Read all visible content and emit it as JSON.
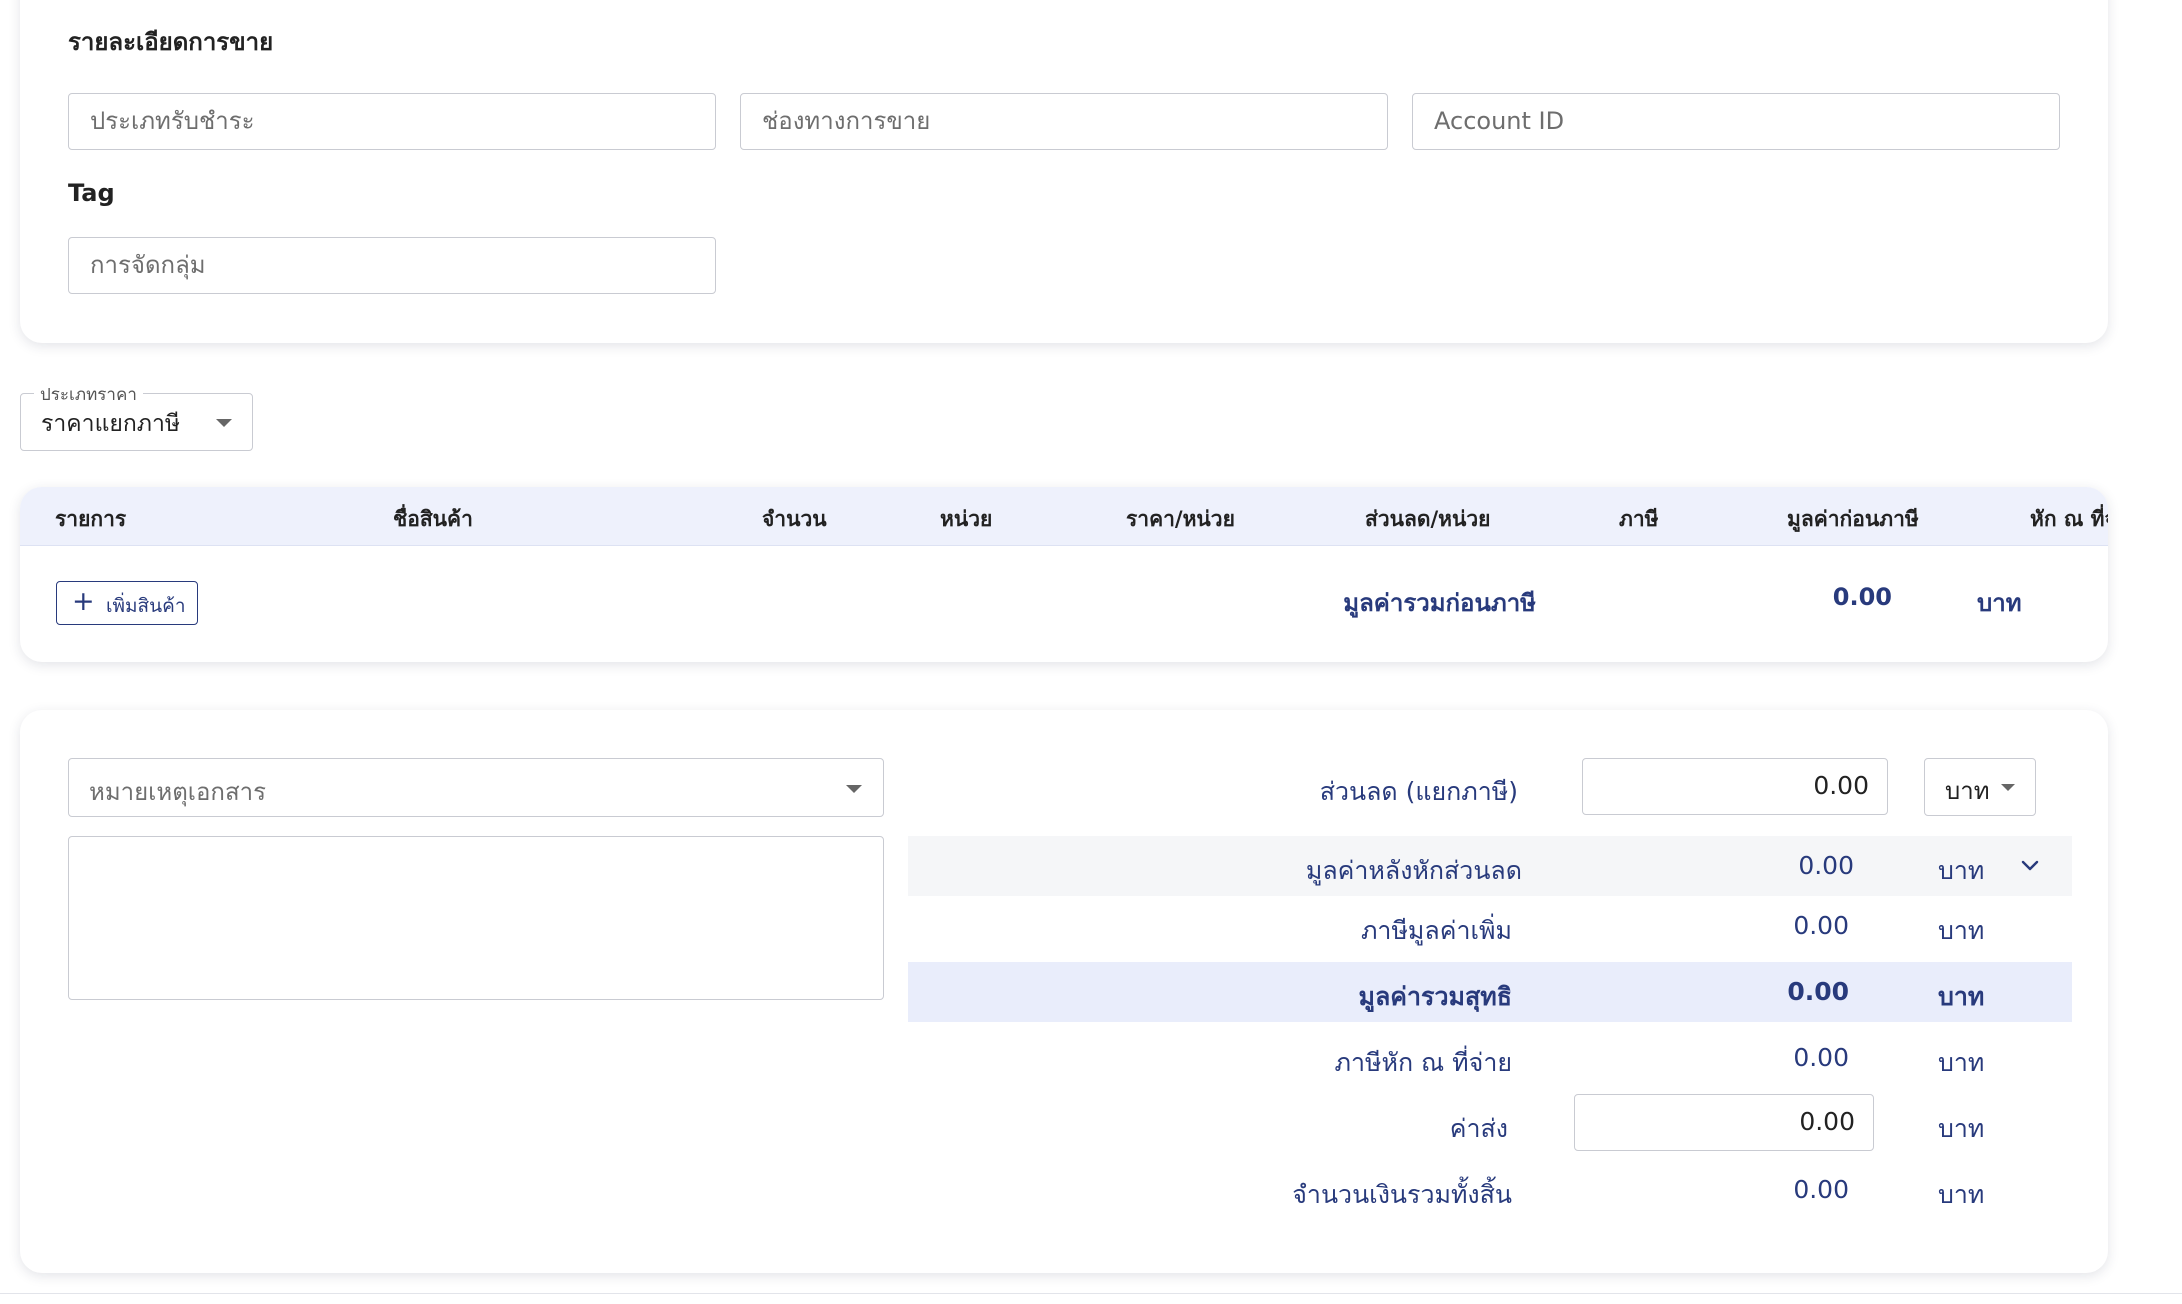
{
  "sales_detail": {
    "title": "รายละเอียดการขาย",
    "payment_type_placeholder": "ประเภทรับชำระ",
    "sales_channel_placeholder": "ช่องทางการขาย",
    "account_id_placeholder": "Account ID",
    "tag_label": "Tag",
    "grouping_placeholder": "การจัดกลุ่ม"
  },
  "price_type": {
    "label": "ประเภทราคา",
    "value": "ราคาแยกภาษี"
  },
  "items_table": {
    "columns": [
      "รายการ",
      "ชื่อสินค้า",
      "จำนวน",
      "หน่วย",
      "ราคา/หน่วย",
      "ส่วนลด/หน่วย",
      "ภาษี",
      "มูลค่าก่อนภาษี",
      "หัก ณ ที่จ่"
    ],
    "add_product_label": "เพิ่มสินค้า",
    "subtotal_label": "มูลค่ารวมก่อนภาษี",
    "subtotal_value": "0.00",
    "currency": "บาท"
  },
  "notes": {
    "dropdown_placeholder": "หมายเหตุเอกสาร",
    "textarea_value": ""
  },
  "summary": {
    "discount_label": "ส่วนลด (แยกภาษี)",
    "discount_value": "0.00",
    "discount_unit": "บาท",
    "after_discount_label": "มูลค่าหลังหักส่วนลด",
    "after_discount_value": "0.00",
    "vat_label": "ภาษีมูลค่าเพิ่ม",
    "vat_value": "0.00",
    "net_total_label": "มูลค่ารวมสุทธิ",
    "net_total_value": "0.00",
    "withholding_label": "ภาษีหัก ณ ที่จ่าย",
    "withholding_value": "0.00",
    "shipping_label": "ค่าส่ง",
    "shipping_value": "0.00",
    "grand_total_label": "จำนวนเงินรวมทั้งสิ้น",
    "grand_total_value": "0.00",
    "unit": "บาท"
  },
  "colors": {
    "accent_navy": "#283a7c",
    "table_header_bg": "#eef1fc",
    "net_total_bg": "#e9edfb",
    "row_bg": "#f5f6f8"
  }
}
